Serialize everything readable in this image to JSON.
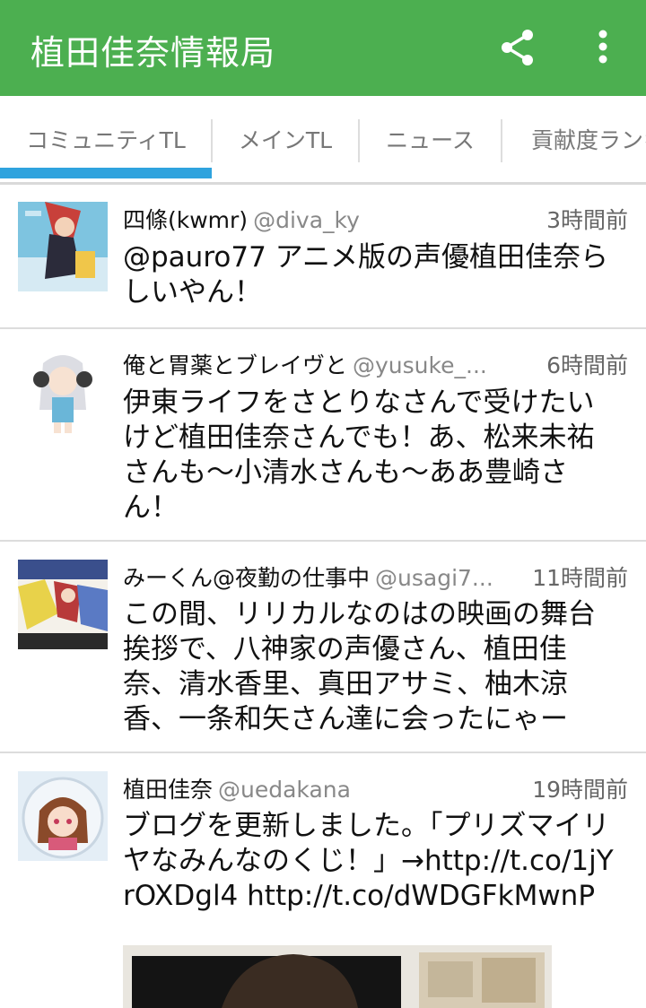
{
  "app": {
    "title": "植田佳奈情報局",
    "bar_color": "#4caf50",
    "actions": [
      "share-icon",
      "more-vert-icon"
    ]
  },
  "tabs": [
    {
      "label": "コミュニティTL",
      "selected": true
    },
    {
      "label": "メインTL",
      "selected": false
    },
    {
      "label": "ニュース",
      "selected": false
    },
    {
      "label": "貢献度ランキ",
      "selected": false
    }
  ],
  "tweets": [
    {
      "author": "四條(kwmr)",
      "handle": "@diva_ky",
      "time": "3時間前",
      "text": "@pauro77 アニメ版の声優植田佳奈らしいやん！"
    },
    {
      "author": "俺と胃薬とブレイヴと",
      "handle": "@yusuke_...",
      "time": "6時間前",
      "text": "伊東ライフをさとりなさんで受けたいけど植田佳奈さんでも！あ、松来未祐さんも〜小清水さんも〜ああ豊崎さん！"
    },
    {
      "author": "みーくん@夜勤の仕事中",
      "handle": "@usagi7...",
      "time": "11時間前",
      "text": "この間、リリカルなのはの映画の舞台挨拶で、八神家の声優さん、植田佳奈、清水香里、真田アサミ、柚木涼香、一条和矢さん達に会ったにゃー"
    },
    {
      "author": "植田佳奈",
      "handle": "@uedakana",
      "time": "19時間前",
      "text": "ブログを更新しました。「プリズマイリヤなみんなのくじ！」→http://t.co/1jYrOXDgl4 http://t.co/dWDGFkMwnP"
    }
  ]
}
